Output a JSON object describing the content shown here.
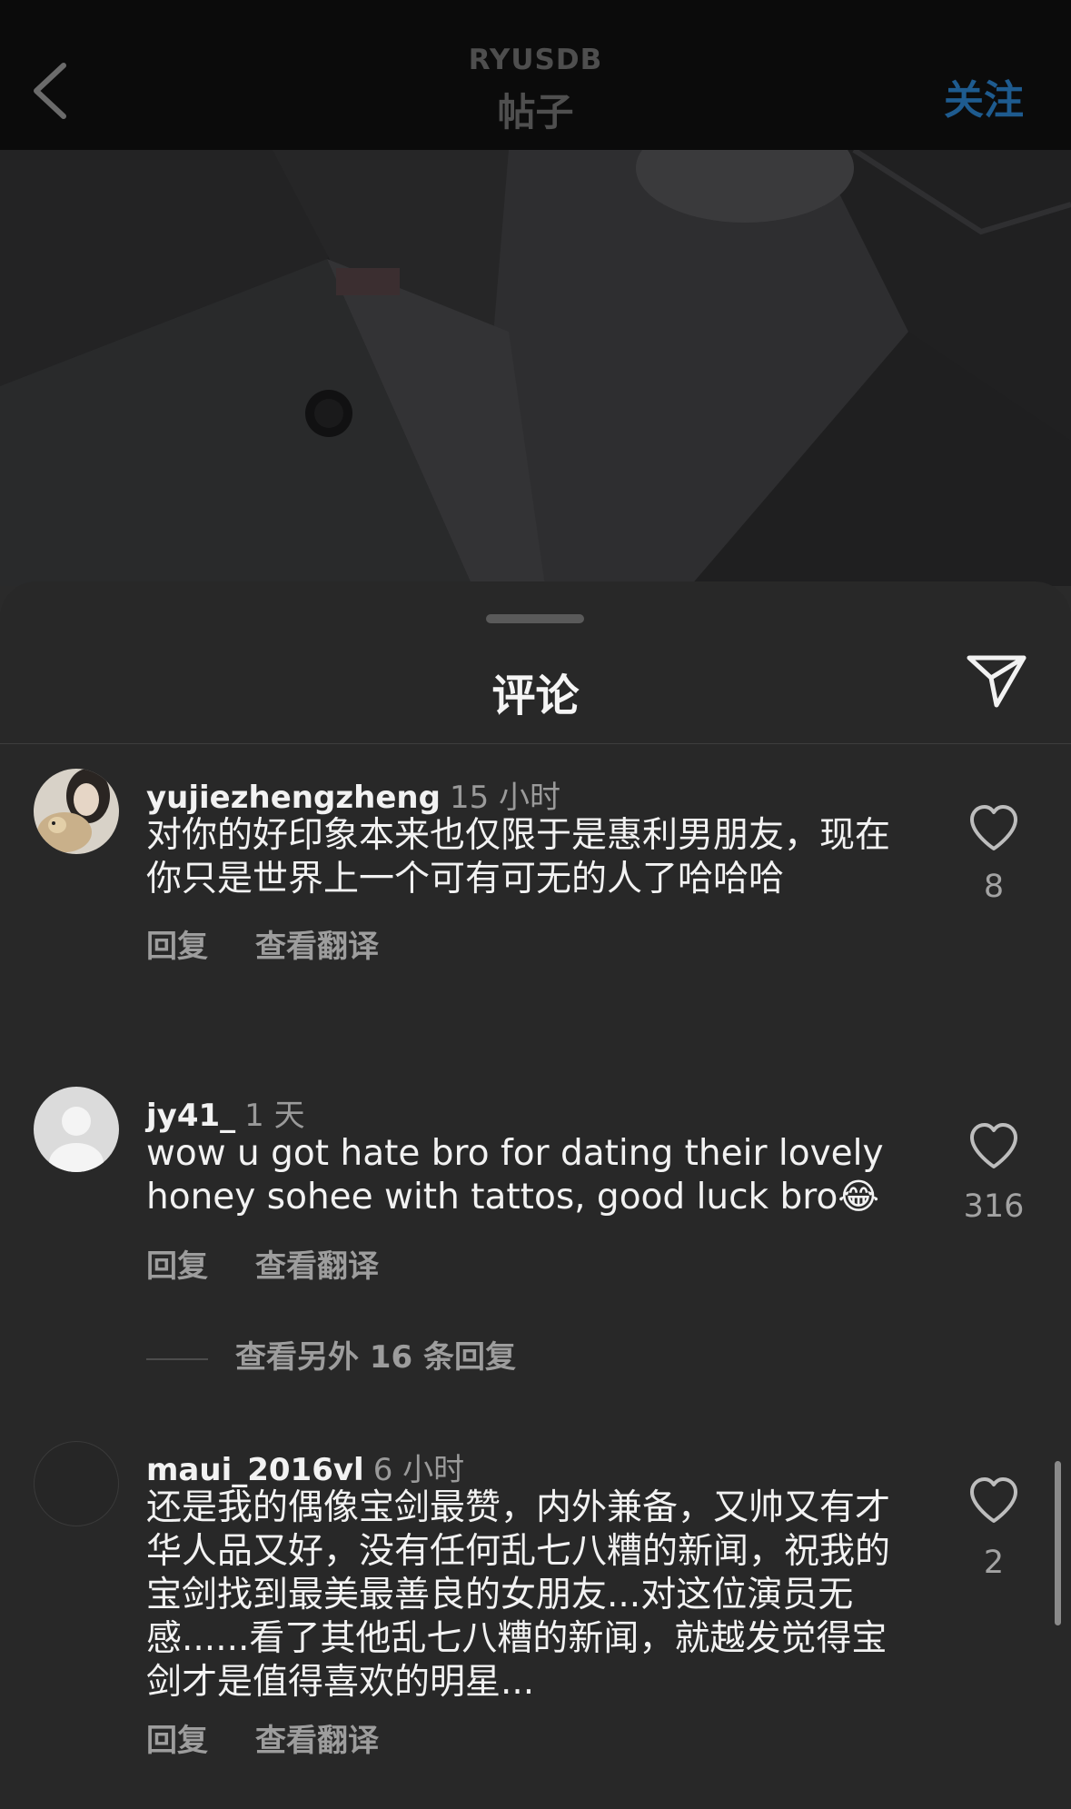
{
  "header": {
    "owner": "RYUSDB",
    "title": "帖子",
    "follow_label": "关注"
  },
  "comments_sheet": {
    "title": "评论",
    "comments": [
      {
        "username": "yujiezhengzheng",
        "time": "15 小时",
        "text": "对你的好印象本来也仅限于是惠利男朋友，现在你只是世界上一个可有可无的人了哈哈哈",
        "likes": "8",
        "reply_label": "回复",
        "translate_label": "查看翻译"
      },
      {
        "username": "jy41_",
        "time": "1 天",
        "text": "wow u got hate bro for dating their lovely honey sohee with tattos, good luck bro😂",
        "likes": "316",
        "reply_label": "回复",
        "translate_label": "查看翻译",
        "more_replies_label": "查看另外 16 条回复"
      },
      {
        "username": "maui_2016vl",
        "time": "6 小时",
        "text": "还是我的偶像宝剑最赞，内外兼备，又帅又有才华人品又好，没有任何乱七八糟的新闻，祝我的宝剑找到最美最善良的女朋友...对这位演员无感......看了其他乱七八糟的新闻，就越发觉得宝剑才是值得喜欢的明星...",
        "likes": "2",
        "reply_label": "回复",
        "translate_label": "查看翻译"
      }
    ]
  },
  "colors": {
    "topbar": "#0b0b0b",
    "sheet": "#282828",
    "follow": "#1e5b8f",
    "secondary_text": "#9d9d9d"
  },
  "icons": [
    "chevron-left-icon",
    "paper-plane-icon",
    "heart-outline-icon",
    "default-avatar-icon"
  ]
}
